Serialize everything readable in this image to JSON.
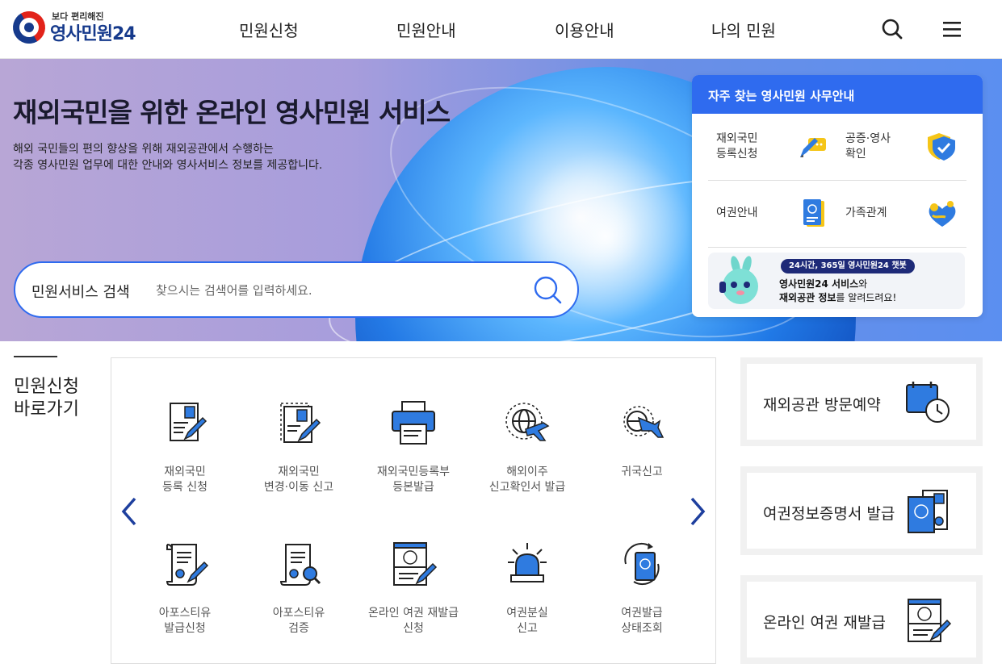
{
  "logo": {
    "sub": "보다 편리해진",
    "main": "영사민원24"
  },
  "nav": {
    "items": [
      "민원신청",
      "민원안내",
      "이용안내",
      "나의 민원"
    ]
  },
  "icons": {
    "search": "search-icon",
    "menu": "hamburger-menu-icon"
  },
  "hero": {
    "title": "재외국민을 위한 온라인 영사민원 서비스",
    "desc_line1": "해외 국민들의 편의 향상을 위해 재외공관에서 수행하는",
    "desc_line2": "각종 영사민원 업무에 대한 안내와 영사서비스 정보를 제공합니다."
  },
  "search": {
    "label": "민원서비스 검색",
    "placeholder": "찾으시는 검색어를 입력하세요."
  },
  "faq": {
    "title": "자주 찾는 영사민원 사무안내",
    "items": [
      {
        "label": "재외국민\n등록신청",
        "icon": "pencil-card-icon"
      },
      {
        "label": "공증·영사\n확인",
        "icon": "shield-check-icon"
      },
      {
        "label": "여권안내",
        "icon": "passport-icon"
      },
      {
        "label": "가족관계",
        "icon": "family-heart-icon"
      }
    ],
    "chatbot": {
      "badge": "24시간, 365일 영사민원24 챗봇",
      "line1_bold": "영사민원24 서비스",
      "line1_rest": "와",
      "line2_bold": "재외공관 정보",
      "line2_rest": "를 알려드려요!"
    }
  },
  "quick": {
    "title_line1": "민원신청",
    "title_line2": "바로가기",
    "items": [
      {
        "label": "재외국민\n등록 신청",
        "icon": "registration-form-icon"
      },
      {
        "label": "재외국민\n변경·이동 신고",
        "icon": "change-form-icon"
      },
      {
        "label": "재외국민등록부\n등본발급",
        "icon": "printer-icon"
      },
      {
        "label": "해외이주\n신고확인서 발급",
        "icon": "globe-plane-icon"
      },
      {
        "label": "귀국신고",
        "icon": "return-plane-icon"
      },
      {
        "label": "아포스티유\n발급신청",
        "icon": "apostille-scroll-icon"
      },
      {
        "label": "아포스티유\n검증",
        "icon": "apostille-verify-icon"
      },
      {
        "label": "온라인 여권 재발급\n신청",
        "icon": "online-passport-icon"
      },
      {
        "label": "여권분실\n신고",
        "icon": "siren-icon"
      },
      {
        "label": "여권발급\n상태조회",
        "icon": "passport-status-icon"
      }
    ]
  },
  "side": [
    {
      "label": "재외공관 방문예약",
      "icon": "calendar-clock-icon"
    },
    {
      "label": "여권정보증명서 발급",
      "icon": "passport-certificate-icon"
    },
    {
      "label": "온라인 여권 재발급",
      "icon": "online-reissue-icon"
    }
  ],
  "colors": {
    "primary": "#2f6bef",
    "navy": "#163a8c",
    "iconBlue": "#2f7be0"
  }
}
